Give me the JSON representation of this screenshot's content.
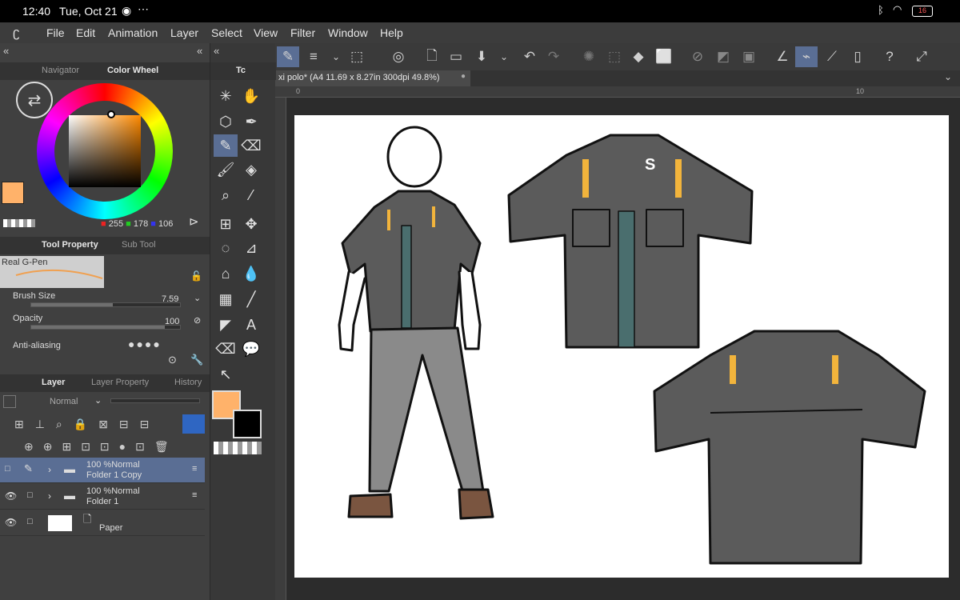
{
  "statusbar": {
    "time": "12:40",
    "date": "Tue, Oct 21",
    "battery": "16"
  },
  "menu": {
    "items": [
      "File",
      "Edit",
      "Animation",
      "Layer",
      "Select",
      "View",
      "Filter",
      "Window",
      "Help"
    ]
  },
  "document": {
    "tab_title": "xi polo* (A4 11.69 x 8.27in 300dpi 49.8%)"
  },
  "ruler": {
    "marks": [
      "0",
      "10"
    ]
  },
  "color_panel": {
    "tabs": [
      "Navigator",
      "Color Wheel"
    ],
    "rgb": {
      "r": "255",
      "g": "178",
      "b": "106"
    },
    "main_color": "#ffb26a",
    "sub_color": "#000000"
  },
  "tool_property": {
    "tabs": [
      "Tool Property",
      "Sub Tool"
    ],
    "brush_name": "Real G-Pen",
    "brush_size_label": "Brush Size",
    "brush_size_value": "7.59",
    "brush_size_fraction": 0.55,
    "opacity_label": "Opacity",
    "opacity_value": "100",
    "opacity_fraction": 0.9,
    "antialiasing_label": "Anti-aliasing"
  },
  "layer_panel": {
    "tabs": [
      "Layer",
      "Layer Property",
      "History"
    ],
    "blend_mode": "Normal",
    "layers": [
      {
        "line1": "100 %Normal",
        "line2": "Folder 1 Copy",
        "selected": true
      },
      {
        "line1": "100 %Normal",
        "line2": "Folder 1",
        "selected": false
      },
      {
        "line1": "",
        "line2": "Paper",
        "selected": false
      }
    ]
  },
  "toolbox": {
    "tab_label": "Tc"
  },
  "colors": {
    "accent": "#5a6e94",
    "shirt": "#5b5b5b",
    "stripe": "#4a6e6e",
    "yellow": "#f2b43c",
    "pants": "#8a8a8a",
    "shoes": "#7a5540",
    "skin": "#ffffff"
  }
}
